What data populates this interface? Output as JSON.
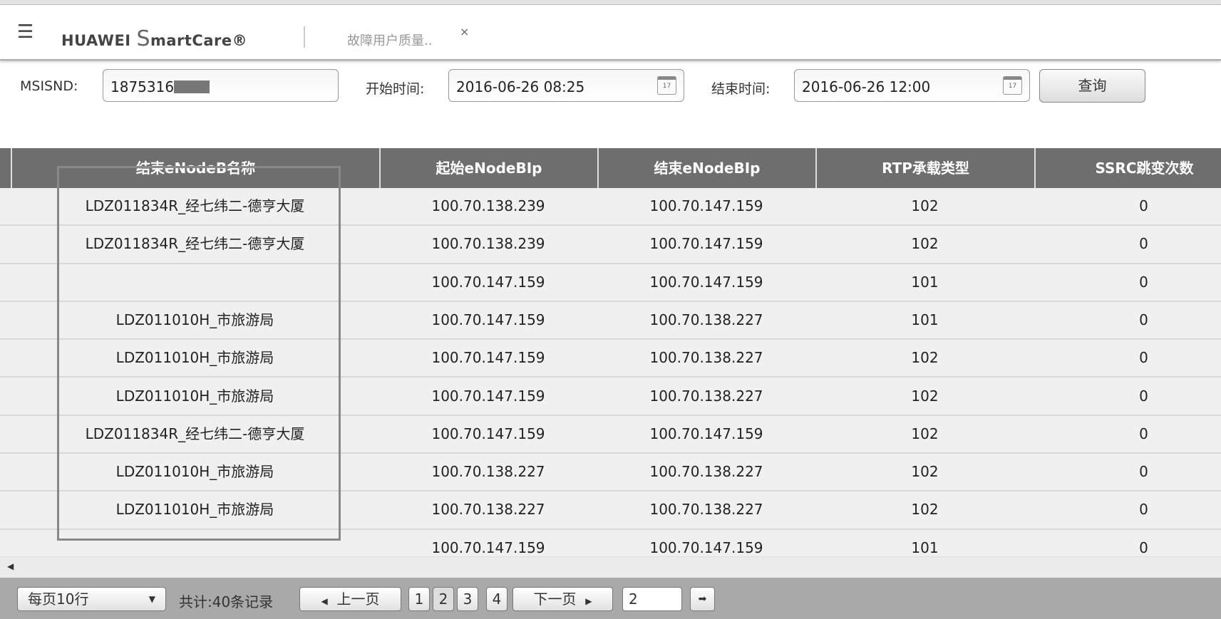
{
  "header": {
    "brand_prefix": "HUAWEI",
    "brand_s": "S",
    "brand_rest": "martCare®",
    "tab_label": "故障用户质量..",
    "tab_close": "×"
  },
  "query": {
    "msisdn_label": "MSISND:",
    "msisdn_value": "1875316",
    "start_label": "开始时间:",
    "start_value": "2016-06-26 08:25",
    "end_label": "结束时间:",
    "end_value": "2016-06-26 12:00",
    "calendar_day": "17",
    "submit_label": "查询"
  },
  "table": {
    "columns": [
      "结束eNodeB名称",
      "起始eNodeBIp",
      "结束eNodeBIp",
      "RTP承载类型",
      "SSRC跳变次数"
    ],
    "rows": [
      [
        "LDZ011834R_经七纬二-德亨大厦",
        "100.70.138.239",
        "100.70.147.159",
        "102",
        "0"
      ],
      [
        "LDZ011834R_经七纬二-德亨大厦",
        "100.70.138.239",
        "100.70.147.159",
        "102",
        "0"
      ],
      [
        "",
        "100.70.147.159",
        "100.70.147.159",
        "101",
        "0"
      ],
      [
        "LDZ011010H_市旅游局",
        "100.70.147.159",
        "100.70.138.227",
        "101",
        "0"
      ],
      [
        "LDZ011010H_市旅游局",
        "100.70.147.159",
        "100.70.138.227",
        "102",
        "0"
      ],
      [
        "LDZ011010H_市旅游局",
        "100.70.147.159",
        "100.70.138.227",
        "102",
        "0"
      ],
      [
        "LDZ011834R_经七纬二-德亨大厦",
        "100.70.147.159",
        "100.70.147.159",
        "102",
        "0"
      ],
      [
        "LDZ011010H_市旅游局",
        "100.70.138.227",
        "100.70.138.227",
        "102",
        "0"
      ],
      [
        "LDZ011010H_市旅游局",
        "100.70.138.227",
        "100.70.138.227",
        "102",
        "0"
      ],
      [
        "",
        "100.70.147.159",
        "100.70.147.159",
        "101",
        "0"
      ]
    ]
  },
  "pager": {
    "page_size": "每页10行",
    "total": "共计:40条记录",
    "prev": "上一页",
    "pages": [
      "1",
      "2",
      "3",
      "4"
    ],
    "current_page": "2",
    "next": "下一页",
    "goto_value": "2"
  }
}
